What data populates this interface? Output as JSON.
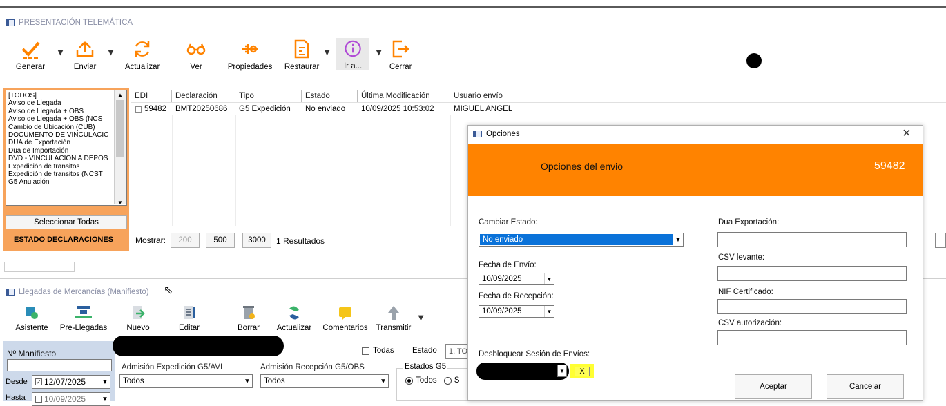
{
  "top_window": {
    "title": "PRESENTACIÓN TELEMÁTICA",
    "toolbar": [
      {
        "label": "Generar",
        "icon": "check-icon"
      },
      {
        "label": "Enviar",
        "icon": "upload-icon"
      },
      {
        "label": "Actualizar",
        "icon": "refresh-icon"
      },
      {
        "label": "Ver",
        "icon": "glasses-icon"
      },
      {
        "label": "Propiedades",
        "icon": "properties-icon"
      },
      {
        "label": "Restaurar",
        "icon": "restore-icon"
      },
      {
        "label": "Ir a...",
        "icon": "info-icon"
      },
      {
        "label": "Cerrar",
        "icon": "exit-icon"
      }
    ],
    "type_list": [
      "[TODOS]",
      "Aviso de Llegada",
      "Aviso de Llegada + OBS",
      "Aviso de Llegada + OBS (NCS",
      "Cambio de Ubicación (CUB)",
      "DOCUMENTO DE VINCULACIC",
      "DUA de Exportación",
      "Dua de Importación",
      "DVD - VINCULACION A DEPOS",
      "Expedición de transitos",
      "Expedición de transitos (NCST",
      "G5 Anulación"
    ],
    "select_all_label": "Seleccionar Todas",
    "estado_label": "ESTADO DECLARACIONES",
    "grid": {
      "columns": [
        "EDI",
        "Declaración",
        "Tipo",
        "Estado",
        "Última Modificación",
        "Usuario envío"
      ],
      "rows": [
        [
          "59482",
          "BMT20250686",
          "G5 Expedición",
          "No enviado",
          "10/09/2025 10:53:02",
          "MIGUEL ANGEL"
        ]
      ]
    },
    "mostrar_label": "Mostrar:",
    "page_sizes": [
      "200",
      "500",
      "3000"
    ],
    "results": "1 Resultados"
  },
  "bottom_window": {
    "title": "Llegadas de Mercancías (Manifiesto)",
    "toolbar": [
      {
        "label": "Asistente"
      },
      {
        "label": "Pre-Llegadas"
      },
      {
        "label": "Nuevo"
      },
      {
        "label": "Editar"
      },
      {
        "label": "Borrar"
      },
      {
        "label": "Actualizar"
      },
      {
        "label": "Comentarios"
      },
      {
        "label": "Transmitir"
      }
    ],
    "manifiesto_label": "Nº Manifiesto",
    "desde_label": "Desde",
    "desde_value": "12/07/2025",
    "hasta_label": "Hasta",
    "hasta_value": "10/09/2025",
    "todas_label": "Todas",
    "estado_label": "Estado",
    "estado_value": "1. TO",
    "adm_exp_label": "Admisión Expedición G5/AVI",
    "adm_exp_value": "Todos",
    "adm_rec_label": "Admisión Recepción G5/OBS",
    "adm_rec_value": "Todos",
    "estados_g5_label": "Estados G5",
    "estados_g5_opt1": "Todos",
    "estados_g5_opt2": "S"
  },
  "dialog": {
    "title": "Opciones",
    "close": "×",
    "header": "Opciones del envio",
    "number": "59482",
    "cambiar_estado_label": "Cambiar Estado:",
    "cambiar_estado_value": "No enviado",
    "fecha_envio_label": "Fecha de Envío:",
    "fecha_envio_value": "10/09/2025",
    "fecha_recepcion_label": "Fecha de Recepción:",
    "fecha_recepcion_value": "10/09/2025",
    "desbloquear_label": "Desbloquear Sesión de Envíos:",
    "desbloquear_x": "X",
    "dua_label": "Dua Exportación:",
    "csv_levante_label": "CSV levante:",
    "nif_label": "NIF Certificado:",
    "csv_aut_label": "CSV autorización:",
    "aceptar": "Aceptar",
    "cancelar": "Cancelar"
  },
  "colors": {
    "orange": "#ff8300",
    "list_border": "#f5a657",
    "selection_blue": "#0a72d9",
    "yellow": "#ffff33"
  }
}
